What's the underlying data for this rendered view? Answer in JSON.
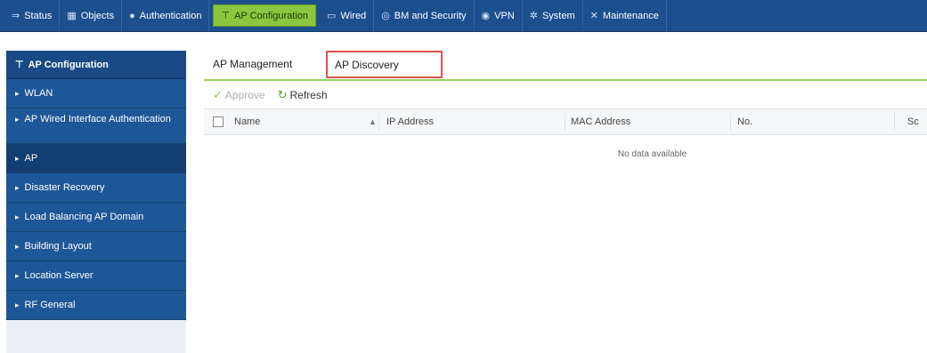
{
  "topnav": [
    {
      "label": "Status",
      "icon": "status-icon",
      "glyph": "⇒"
    },
    {
      "label": "Objects",
      "icon": "objects-icon",
      "glyph": "▦"
    },
    {
      "label": "Authentication",
      "icon": "user-icon",
      "glyph": "●"
    },
    {
      "label": "AP Configuration",
      "icon": "ap-icon",
      "glyph": "⊤",
      "active": true
    },
    {
      "label": "Wired",
      "icon": "wired-icon",
      "glyph": "▭"
    },
    {
      "label": "BM and Security",
      "icon": "security-icon",
      "glyph": "◎"
    },
    {
      "label": "VPN",
      "icon": "vpn-icon",
      "glyph": "◉"
    },
    {
      "label": "System",
      "icon": "system-icon",
      "glyph": "✲"
    },
    {
      "label": "Maintenance",
      "icon": "maintenance-icon",
      "glyph": "✕"
    }
  ],
  "sidebar": {
    "title": "AP Configuration",
    "items": [
      {
        "label": "WLAN"
      },
      {
        "label": "AP Wired Interface Authentication"
      },
      {
        "label": "AP",
        "selected": true
      },
      {
        "label": "Disaster Recovery"
      },
      {
        "label": "Load Balancing AP Domain"
      },
      {
        "label": "Building Layout"
      },
      {
        "label": "Location Server"
      },
      {
        "label": "RF General"
      }
    ]
  },
  "subtabs": {
    "management": "AP Management",
    "discovery": "AP Discovery"
  },
  "toolbar": {
    "approve": "Approve",
    "refresh": "Refresh"
  },
  "grid": {
    "columns": {
      "name": "Name",
      "ip": "IP Address",
      "mac": "MAC Address",
      "no": "No.",
      "extra": "Sc"
    },
    "empty": "No data available"
  },
  "colors": {
    "nav": "#1c4f8d",
    "active_tab": "#8cc63f",
    "highlight": "#e05050"
  }
}
